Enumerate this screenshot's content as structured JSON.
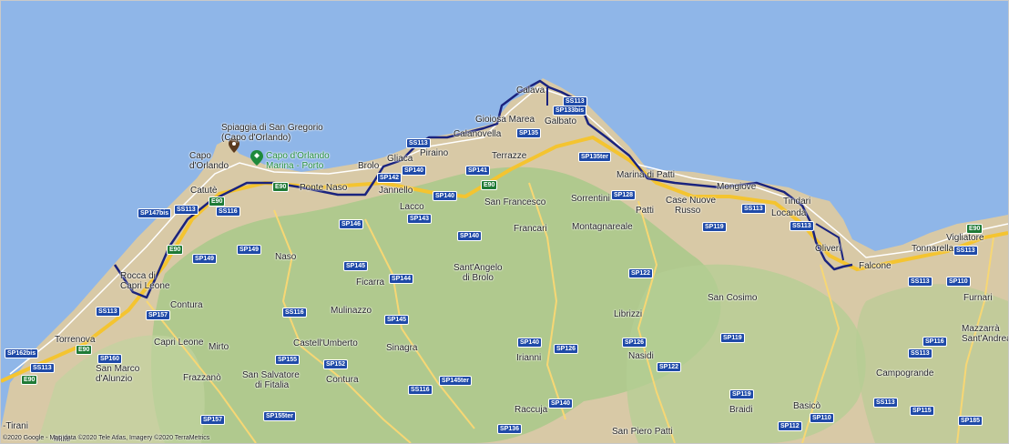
{
  "map": {
    "colors": {
      "sea": "#8fb6e8",
      "land": "#d8c9a6",
      "hills": "#a9c98a",
      "route": "#1a237e",
      "highway": "#f4c430",
      "poi_brown": "#5b3a1e",
      "poi_green": "#1e8a3c"
    },
    "labels": {
      "spiaggia_line1": "Spiaggia di San Gregorio",
      "spiaggia_line2": "(Capo d'Orlando)",
      "capo_orlando_line1": "Capo",
      "capo_orlando_line2": "d'Orlando",
      "marina_porto_line1": "Capo d'Orlando",
      "marina_porto_line2": "Marina - Porto",
      "catute": "Catutè",
      "ponte_naso": "Ponte Naso",
      "brolo": "Brolo",
      "gliaca": "Gliaca",
      "piraino": "Piraino",
      "jannello": "Jannello",
      "lacco": "Lacco",
      "calanovella": "Calanovella",
      "gioiosa_marea": "Gioiosa Marea",
      "galbato": "Galbato",
      "calava": "Calava",
      "terrazze": "Terrazze",
      "san_francesco": "San Francesco",
      "francari": "Francari",
      "sorrentini": "Sorrentini",
      "marina_di_patti": "Marina di Patti",
      "patti": "Patti",
      "case_nuove_russo_1": "Case Nuove",
      "case_nuove_russo_2": "Russo",
      "mongiove": "Mongiove",
      "tindari": "Tindari",
      "locanda": "Locanda",
      "oliveri": "Oliveri",
      "falcone": "Falcone",
      "tonnarella": "Tonnarella",
      "vigliatore": "Vigliatore",
      "montagnareale": "Montagnareale",
      "naso": "Naso",
      "ficarra": "Ficarra",
      "mulinazzo": "Mulinazzo",
      "castell_umberto": "Castell'Umberto",
      "sinagra": "Sinagra",
      "sant_angelo_1": "Sant'Angelo",
      "sant_angelo_2": "di Brolo",
      "rocca_1": "Rocca di",
      "rocca_2": "Capri Leone",
      "contura_1": "Contura",
      "contura_2": "Contura",
      "torrenova": "Torrenova",
      "capri_leone": "Capri Leone",
      "mirto": "Mirto",
      "san_marco_1": "San Marco",
      "san_marco_2": "d'Alunzio",
      "frazzano": "Frazzanò",
      "san_salvatore_1": "San Salvatore",
      "san_salvatore_2": "di Fitalia",
      "irianni": "Irianni",
      "raccuja": "Raccuja",
      "san_piero_patti": "San Piero Patti",
      "librizzi": "Librizzi",
      "nasidi": "Nasidi",
      "san_cosimo": "San Cosimo",
      "braidi": "Braidi",
      "basico": "Basicò",
      "campogrande": "Campogrande",
      "furnari": "Furnari",
      "mazzarra_1": "Mazzarrà",
      "mazzarra_2": "Sant'Andrea",
      "tirani": "-Tirani",
      "militi": "Militi"
    },
    "shields": {
      "ss113_a": "SS113",
      "ss113_b": "SS113",
      "ss113_c": "SS113",
      "ss113_d": "SS113",
      "ss113_e": "SS113",
      "ss113_f": "SS113",
      "ss113_g": "SS113",
      "ss113_h": "SS113",
      "ss113_i": "SS113",
      "ss113_j": "SS113",
      "e90_a": "E90",
      "e90_b": "E90",
      "e90_c": "E90",
      "e90_d": "E90",
      "e90_e": "E90",
      "e90_f": "E90",
      "e90_g": "E90",
      "sp147bis": "SP147bis",
      "ss116_a": "SS116",
      "ss116_b": "SS116",
      "ss116_c": "SS116",
      "sp149_a": "SP149",
      "sp149_b": "SP149",
      "sp146": "SP146",
      "sp145_a": "SP145",
      "sp145_b": "SP145",
      "sp144": "SP144",
      "sp142": "SP142",
      "sp140_a": "SP140",
      "sp140_b": "SP140",
      "sp140_c": "SP140",
      "sp140_d": "SP140",
      "sp140_e": "SP140",
      "sp143": "SP143",
      "sp141": "SP141",
      "sp135": "SP135",
      "sp135ter": "SP135ter",
      "sp133bis": "SP133bis",
      "sp128": "SP128",
      "sp119_a": "SP119",
      "sp119_b": "SP119",
      "sp119_c": "SP119",
      "sp122_a": "SP122",
      "sp122_b": "SP122",
      "sp126_a": "SP126",
      "sp126_b": "SP126",
      "sp157_a": "SP157",
      "sp157_b": "SP157",
      "sp160": "SP160",
      "sp155": "SP155",
      "sp155ter": "SP155ter",
      "sp152": "SP152",
      "sp145ter": "SP145ter",
      "sp136": "SP136",
      "sp112": "SP112",
      "sp110_a": "SP110",
      "sp110_b": "SP110",
      "sp116": "SP116",
      "sp115": "SP115",
      "sp185": "SP185",
      "sp162bis": "SP162bis"
    },
    "attribution": "©2020 Google - Map data ©2020 Tele Atlas, Imagery ©2020 TerraMetrics"
  }
}
